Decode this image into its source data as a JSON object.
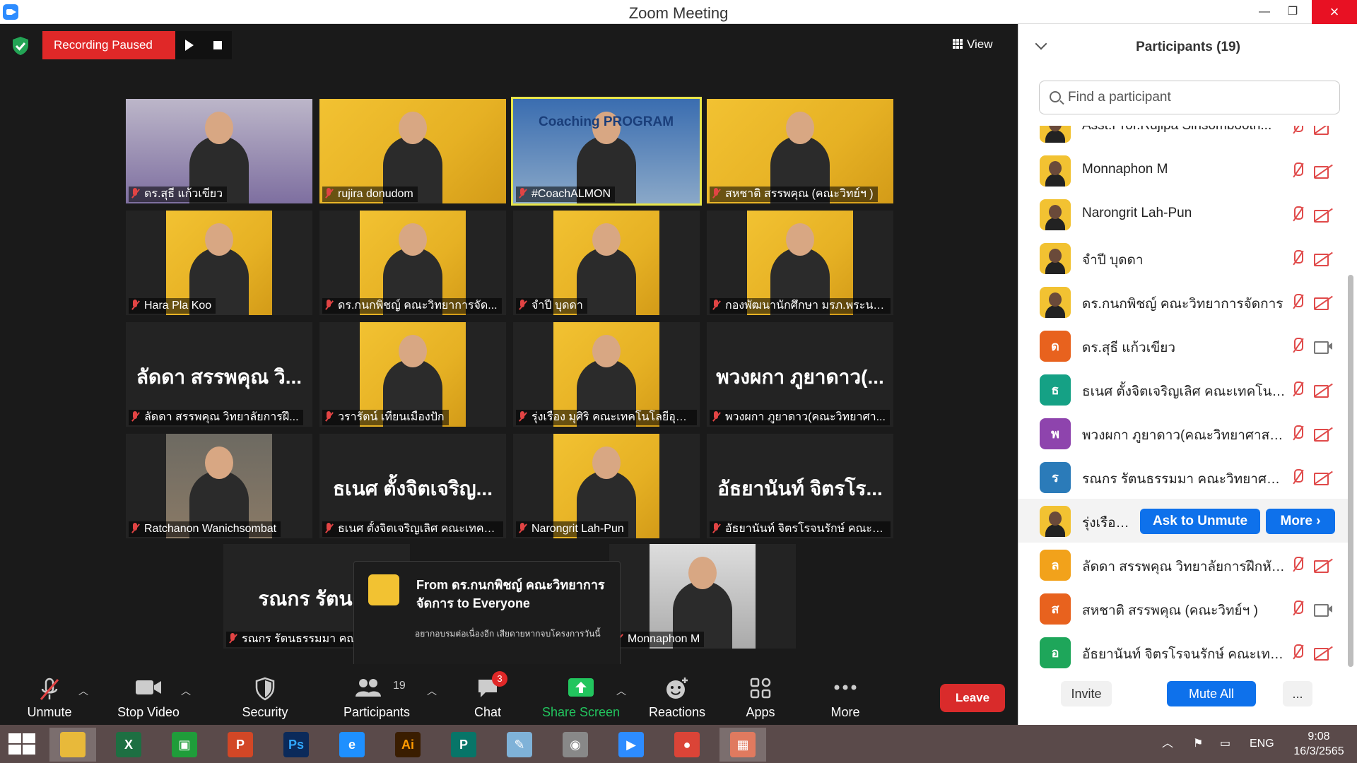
{
  "window": {
    "title": "Zoom Meeting"
  },
  "recording": {
    "label": "Recording Paused"
  },
  "view_button": {
    "label": "View"
  },
  "tiles": [
    {
      "name": "ดร.สุธี  แก้วเขียว",
      "style": "purple",
      "active": false
    },
    {
      "name": "rujira donudom",
      "style": "yellow",
      "active": false
    },
    {
      "name": "#CoachALMON",
      "style": "coach",
      "active": true,
      "banner": "Coaching PROGRAM"
    },
    {
      "name": "สหชาติ สรรพคุณ (คณะวิทย์ฯ )",
      "style": "yellow",
      "active": false
    },
    {
      "name": "Hara Pla Koo",
      "style": "yellow-center",
      "active": false
    },
    {
      "name": "ดร.กนกพิชญ์ คณะวิทยาการจัด...",
      "style": "yellow-center",
      "active": false
    },
    {
      "name": "จำปี บุดดา",
      "style": "yellow-center",
      "active": false
    },
    {
      "name": "กองพัฒนานักศึกษา มรภ.พระนคร",
      "style": "yellow-center",
      "active": false
    },
    {
      "name": "ลัดดา สรรพคุณ วิทยาลัยการฝึ...",
      "big": "ลัดดา สรรพคุณ วิ...",
      "active": false
    },
    {
      "name": "วรารัตน์ เทียนเมืองปัก",
      "style": "yellow-center",
      "active": false
    },
    {
      "name": "รุ่งเรือง มุศิริ คณะเทคโนโลยีอุตส...",
      "style": "yellow-center",
      "active": false
    },
    {
      "name": "พวงผกา ภูยาดาว(คณะวิทยาศา...",
      "big": "พวงผกา ภูยาดาว(...",
      "active": false
    },
    {
      "name": "Ratchanon Wanichsombat",
      "style": "restaurant",
      "active": false
    },
    {
      "name": "ธเนศ ตั้งจิตเจริญเลิศ คณะเทคโน...",
      "big": "ธเนศ ตั้งจิตเจริญ...",
      "active": false
    },
    {
      "name": "Narongrit Lah-Pun",
      "style": "yellow-center",
      "active": false
    },
    {
      "name": "อัธยานันท์ จิตรโรจนรักษ์ คณะเท...",
      "big": "อัธยานันท์ จิตรโร...",
      "active": false
    },
    {
      "name": "รณกร รัตนธรรมมา คณ",
      "big": "รณกร รัตนธร",
      "active": false
    },
    {
      "name": "Monnaphon M",
      "style": "grey-center",
      "active": false
    }
  ],
  "chat_popup": {
    "from": "From ดร.กนกพิชญ์ คณะวิทยาการจัดการ to Everyone",
    "message": "อยากอบรมต่อเนื่องอีก เสียดายหากจบโครงการวันนี้"
  },
  "toolbar": {
    "unmute": "Unmute",
    "stop_video": "Stop Video",
    "security": "Security",
    "participants": "Participants",
    "participants_count": "19",
    "chat": "Chat",
    "chat_badge": "3",
    "share_screen": "Share Screen",
    "reactions": "Reactions",
    "apps": "Apps",
    "more": "More",
    "leave": "Leave"
  },
  "panel": {
    "title": "Participants (19)",
    "search_placeholder": "Find a participant",
    "participants": [
      {
        "name": "Asst.Prof.Rujipa Sinsombooth...",
        "avatar": "photo",
        "cam": "off"
      },
      {
        "name": "Monnaphon M",
        "avatar": "photo",
        "cam": "off"
      },
      {
        "name": "Narongrit Lah-Pun",
        "avatar": "photo",
        "cam": "off"
      },
      {
        "name": "จำปี บุดดา",
        "avatar": "photo",
        "cam": "off"
      },
      {
        "name": "ดร.กนกพิชญ์ คณะวิทยาการจัดการ",
        "avatar": "photo",
        "cam": "off"
      },
      {
        "name": "ดร.สุธี  แก้วเขียว",
        "avatar": "ด",
        "color": "#e8621e",
        "cam": "on"
      },
      {
        "name": "ธเนศ ตั้งจิตเจริญเลิศ คณะเทคโนโลยีอุ...",
        "avatar": "ธ",
        "color": "#15a185",
        "cam": "off"
      },
      {
        "name": "พวงผกา ภูยาดาว(คณะวิทยาศาสตร์)",
        "avatar": "พ",
        "color": "#8e44ad",
        "cam": "off"
      },
      {
        "name": "รณกร รัตนธรรมมา คณะวิทยาศาสตร์ฯ",
        "avatar": "ร",
        "color": "#2b7bb9",
        "cam": "off"
      },
      {
        "name": "รุ่งเรือง ...",
        "avatar": "photo",
        "hover": true
      },
      {
        "name": "ลัดดา สรรพคุณ วิทยาลัยการฝึกหัดครู",
        "avatar": "ล",
        "color": "#f2a21b",
        "cam": "off"
      },
      {
        "name": "สหชาติ สรรพคุณ (คณะวิทย์ฯ )",
        "avatar": "ส",
        "color": "#e8621e",
        "cam": "on"
      },
      {
        "name": "อัธยานันท์ จิตรโรจนรักษ์ คณะเทคโนโ...",
        "avatar": "อ",
        "color": "#1ea65a",
        "cam": "off"
      }
    ],
    "ask_to_unmute": "Ask to Unmute",
    "more": "More ›",
    "invite": "Invite",
    "mute_all": "Mute All",
    "ellipsis": "..."
  },
  "taskbar": {
    "apps": [
      "file-explorer",
      "excel",
      "store",
      "powerpoint",
      "photoshop",
      "internet-explorer",
      "illustrator",
      "publisher",
      "notepad",
      "photoscape",
      "zoom",
      "chrome",
      "photos"
    ],
    "lang": "ENG",
    "time": "9:08",
    "date": "16/3/2565"
  },
  "colors": {
    "accent": "#0e71eb",
    "recording": "#e02828",
    "leave": "#d92b2b",
    "share": "#22c55e"
  }
}
